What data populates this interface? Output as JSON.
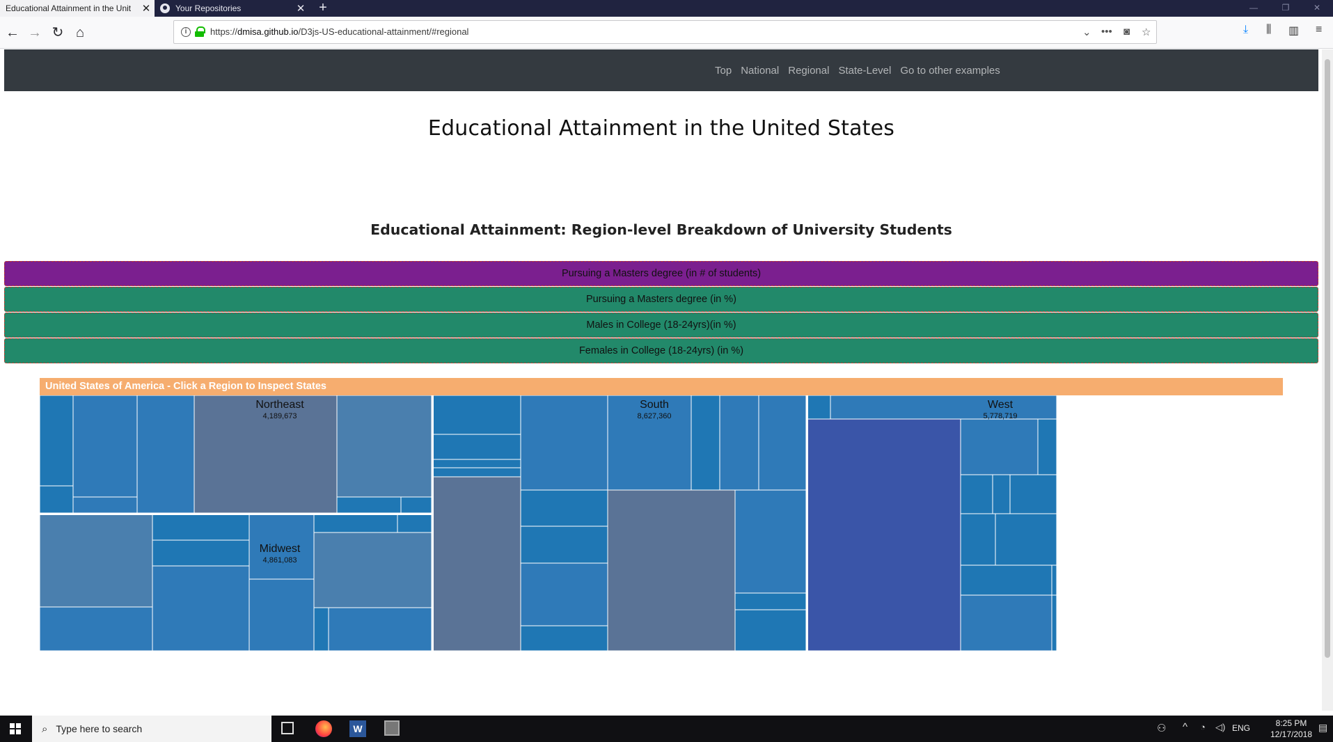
{
  "browser": {
    "tabs": [
      {
        "title": "Educational Attainment in the Unit",
        "active": true
      },
      {
        "title": "Your Repositories",
        "active": false
      }
    ],
    "url_prefix": "https://",
    "url_domain": "dmisa.github.io",
    "url_path": "/D3js-US-educational-attainment/#regional"
  },
  "site_nav": {
    "items": [
      "Top",
      "National",
      "Regional",
      "State-Level",
      "Go to other examples"
    ]
  },
  "page": {
    "title": "Educational Attainment in the United States",
    "subtitle": "Educational Attainment: Region-level Breakdown of University Students"
  },
  "metric_buttons": [
    {
      "label": "Pursuing a Masters degree (in # of students)",
      "active": true
    },
    {
      "label": "Pursuing a Masters degree (in %)",
      "active": false
    },
    {
      "label": "Males in College (18-24yrs)(in %)",
      "active": false
    },
    {
      "label": "Females in College (18-24yrs) (in %)",
      "active": false
    }
  ],
  "treemap": {
    "header": "United States of America - Click a Region to Inspect States",
    "colors": {
      "base": "#1f77b4",
      "dark": "#3a55a8",
      "grey": "#5a7396"
    },
    "regions": [
      {
        "name": "Northeast",
        "value": "4,189,673"
      },
      {
        "name": "Midwest",
        "value": "4,861,083"
      },
      {
        "name": "South",
        "value": "8,627,360"
      },
      {
        "name": "West",
        "value": "5,778,719"
      }
    ]
  },
  "taskbar": {
    "search_placeholder": "Type here to search",
    "lang": "ENG",
    "time": "8:25 PM",
    "date": "12/17/2018"
  }
}
